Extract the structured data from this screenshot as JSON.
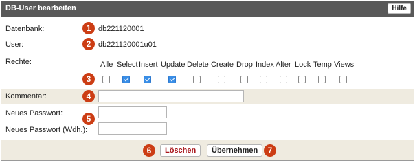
{
  "window": {
    "title": "DB-User bearbeiten",
    "help_label": "Hilfe"
  },
  "fields": {
    "datenbank_label": "Datenbank:",
    "datenbank_value": "db221120001",
    "user_label": "User:",
    "user_value": "db221120001u01",
    "rechte_label": "Rechte:",
    "kommentar_label": "Kommentar:",
    "kommentar_value": "",
    "pw_label": "Neues Passwort:",
    "pw_value": "",
    "pw2_label": "Neues Passwort (Wdh.):",
    "pw2_value": ""
  },
  "permissions": [
    {
      "label": "Alle",
      "checked": false
    },
    {
      "label": "Select",
      "checked": true
    },
    {
      "label": "Insert",
      "checked": true
    },
    {
      "label": "Update",
      "checked": true
    },
    {
      "label": "Delete",
      "checked": false
    },
    {
      "label": "Create",
      "checked": false
    },
    {
      "label": "Drop",
      "checked": false
    },
    {
      "label": "Index",
      "checked": false
    },
    {
      "label": "Alter",
      "checked": false
    },
    {
      "label": "Lock",
      "checked": false
    },
    {
      "label": "Temp",
      "checked": false
    },
    {
      "label": "Views",
      "checked": false
    }
  ],
  "badges": [
    "1",
    "2",
    "3",
    "4",
    "5",
    "6",
    "7"
  ],
  "buttons": {
    "delete_label": "Löschen",
    "apply_label": "Übernehmen"
  },
  "colors": {
    "badge": "#cc3d14",
    "title_bar": "#595959",
    "checked": "#3a8ee6"
  }
}
